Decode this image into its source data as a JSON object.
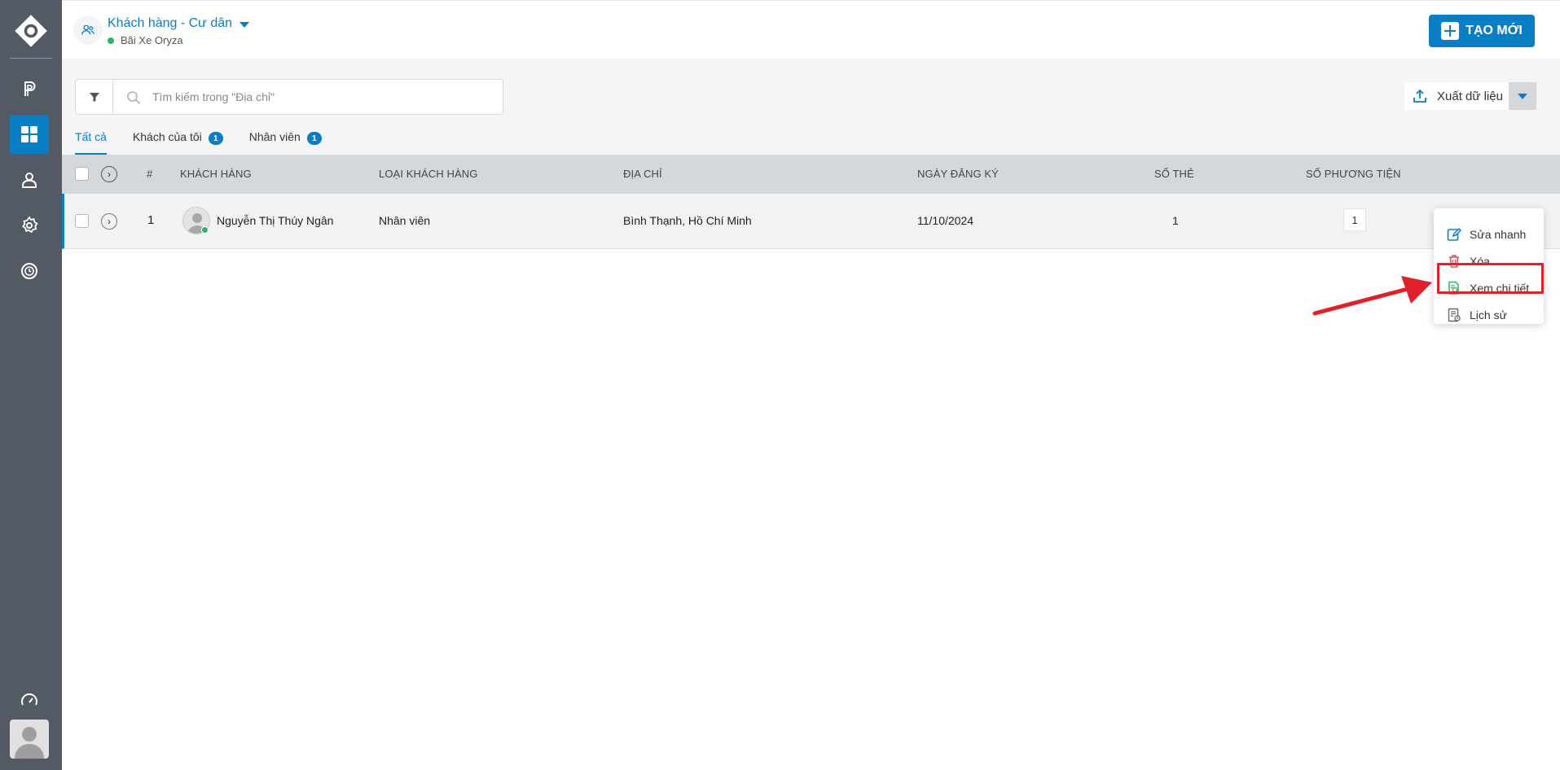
{
  "sidebar": {
    "items": [
      {
        "icon": "parking-icon"
      },
      {
        "icon": "dashboard-grid-icon",
        "active": true
      },
      {
        "icon": "user-icon"
      },
      {
        "icon": "settings-gear-icon"
      },
      {
        "icon": "history-clock-icon"
      }
    ],
    "bottom_icon": "speedometer-icon",
    "avatar": "user-avatar"
  },
  "header": {
    "title": "Khách hàng - Cư dân",
    "subtitle": "Bãi Xe Oryza",
    "create_button": "TẠO MỚI"
  },
  "toolbar": {
    "search_placeholder": "Tìm kiếm trong \"Địa chỉ\"",
    "export_label": "Xuất dữ liệu"
  },
  "tabs": [
    {
      "label": "Tất cả",
      "active": true
    },
    {
      "label": "Khách của tôi",
      "badge": "1"
    },
    {
      "label": "Nhân viên",
      "badge": "1"
    }
  ],
  "table": {
    "columns": {
      "index": "#",
      "customer": "KHÁCH HÀNG",
      "customer_type": "LOẠI KHÁCH HÀNG",
      "address": "ĐỊA CHỈ",
      "registered_date": "NGÀY ĐĂNG KÝ",
      "card_count": "SỐ THẺ",
      "vehicle_count": "SỐ PHƯƠNG TIỆN"
    },
    "rows": [
      {
        "index": "1",
        "customer": "Nguyễn Thị Thúy Ngân",
        "customer_type": "Nhân viên",
        "address": "Bình Thạnh, Hồ Chí Minh",
        "registered_date": "11/10/2024",
        "card_count": "1",
        "vehicle_count": "1"
      }
    ]
  },
  "context_menu": {
    "items": [
      {
        "label": "Sửa nhanh",
        "icon": "edit-icon"
      },
      {
        "label": "Xóa",
        "icon": "trash-icon"
      },
      {
        "label": "Xem chi tiết",
        "icon": "view-detail-icon"
      },
      {
        "label": "Lịch sử",
        "icon": "history-doc-icon"
      }
    ]
  },
  "colors": {
    "primary": "#0a7ec4",
    "sidebar": "#545a63",
    "online": "#2db36b",
    "highlight": "#e0202a"
  }
}
